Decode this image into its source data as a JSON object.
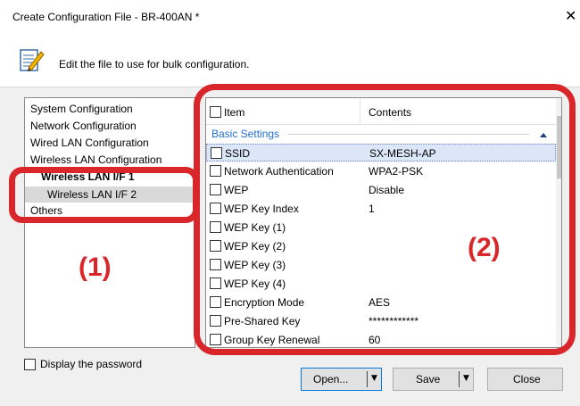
{
  "window": {
    "title": "Create Configuration File - BR-400AN *",
    "close_glyph": "✕"
  },
  "header": {
    "text": "Edit the file to use for bulk configuration.",
    "icon": "notepad-pencil-icon"
  },
  "tree": {
    "items": [
      {
        "label": "System Configuration"
      },
      {
        "label": "Network Configuration"
      },
      {
        "label": "Wired LAN Configuration"
      },
      {
        "label": "Wireless LAN Configuration"
      },
      {
        "label": "Wireless LAN I/F 1"
      },
      {
        "label": "Wireless LAN I/F 2"
      },
      {
        "label": "Others"
      }
    ]
  },
  "list": {
    "col_item": "Item",
    "col_contents": "Contents",
    "group": "Basic Settings",
    "rows": [
      {
        "item": "SSID",
        "value": "SX-MESH-AP",
        "selected": true
      },
      {
        "item": "Network Authentication",
        "value": "WPA2-PSK"
      },
      {
        "item": "WEP",
        "value": "Disable"
      },
      {
        "item": "WEP Key Index",
        "value": "1"
      },
      {
        "item": "WEP Key (1)",
        "value": ""
      },
      {
        "item": "WEP Key (2)",
        "value": ""
      },
      {
        "item": "WEP Key (3)",
        "value": ""
      },
      {
        "item": "WEP Key (4)",
        "value": ""
      },
      {
        "item": "Encryption Mode",
        "value": "AES"
      },
      {
        "item": "Pre-Shared Key",
        "value": "************"
      },
      {
        "item": "Group Key Renewal",
        "value": "60"
      }
    ]
  },
  "display_password": "Display the password",
  "buttons": {
    "open": "Open...",
    "save": "Save",
    "close": "Close"
  },
  "annotations": {
    "one": "(1)",
    "two": "(2)"
  },
  "colors": {
    "accent": "#d9262b",
    "group_blue": "#1f6fd0",
    "selection": "#dbe7f8"
  }
}
